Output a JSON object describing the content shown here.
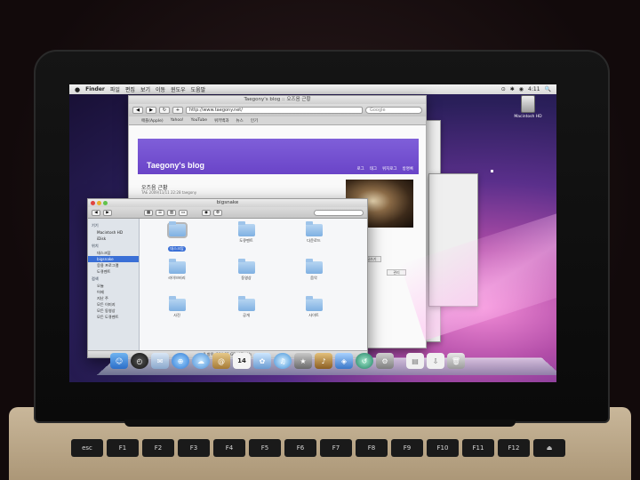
{
  "menubar": {
    "apple": "",
    "app": "Finder",
    "items": [
      "파일",
      "편집",
      "보기",
      "이동",
      "윈도우",
      "도움말"
    ],
    "right": [
      "⊙",
      "✱",
      "◉",
      "4:11",
      "🔍"
    ]
  },
  "browser": {
    "title": "Taegony's blog :: 오즈음 근황",
    "url": "http://www.taegony.net/",
    "search_placeholder": "Google",
    "bookmarks": [
      "애플(Apple)",
      "Yahoo!",
      "YouTube",
      "위키백과",
      "뉴스",
      "인기"
    ],
    "blog_title": "Taegony's blog",
    "nav": [
      "로그",
      "태그",
      "위치로그",
      "방명록"
    ],
    "post_title": "오즈음 근황",
    "post_meta": "TAE 2009/11/11 22:28 taegony",
    "side_buttons": [
      "글쓰기",
      "관리"
    ]
  },
  "finder": {
    "title": "bigsnake",
    "search_placeholder": "",
    "sidebar": {
      "devices_header": "기기",
      "devices": [
        "Macintosh HD",
        "iDisk"
      ],
      "places_header": "위치",
      "places": [
        "데스크탑",
        "bigsnake",
        "응용 프로그램",
        "도큐멘트"
      ],
      "search_header": "검색",
      "searches": [
        "오늘",
        "어제",
        "지난 주",
        "모든 이미지",
        "모든 동영상",
        "모든 도큐멘트"
      ]
    },
    "folders": [
      "데스크탑",
      "도큐멘트",
      "다운로드",
      "라이브러리",
      "동영상",
      "음악",
      "사진",
      "공개",
      "사이트"
    ],
    "status": "9 항목, 104.85 GB 사용 가능"
  },
  "desktop": {
    "drive_label": "Macintosh HD"
  },
  "dock": {
    "icons": [
      "finder-icon",
      "dashboard-icon",
      "mail-icon",
      "safari-icon",
      "ichat-icon",
      "address-book-icon",
      "ical-icon",
      "iphoto-icon",
      "itunes-icon",
      "imovie-icon",
      "garageband-icon",
      "iweb-icon",
      "time-machine-icon",
      "system-preferences-icon",
      "documents-stack-icon",
      "downloads-stack-icon",
      "trash-icon"
    ],
    "ical_day": "14"
  },
  "keyboard": {
    "keys": [
      "esc",
      "F1",
      "F2",
      "F3",
      "F4",
      "F5",
      "F6",
      "F7",
      "F8",
      "F9",
      "F10",
      "F11",
      "F12",
      "⏏"
    ]
  }
}
